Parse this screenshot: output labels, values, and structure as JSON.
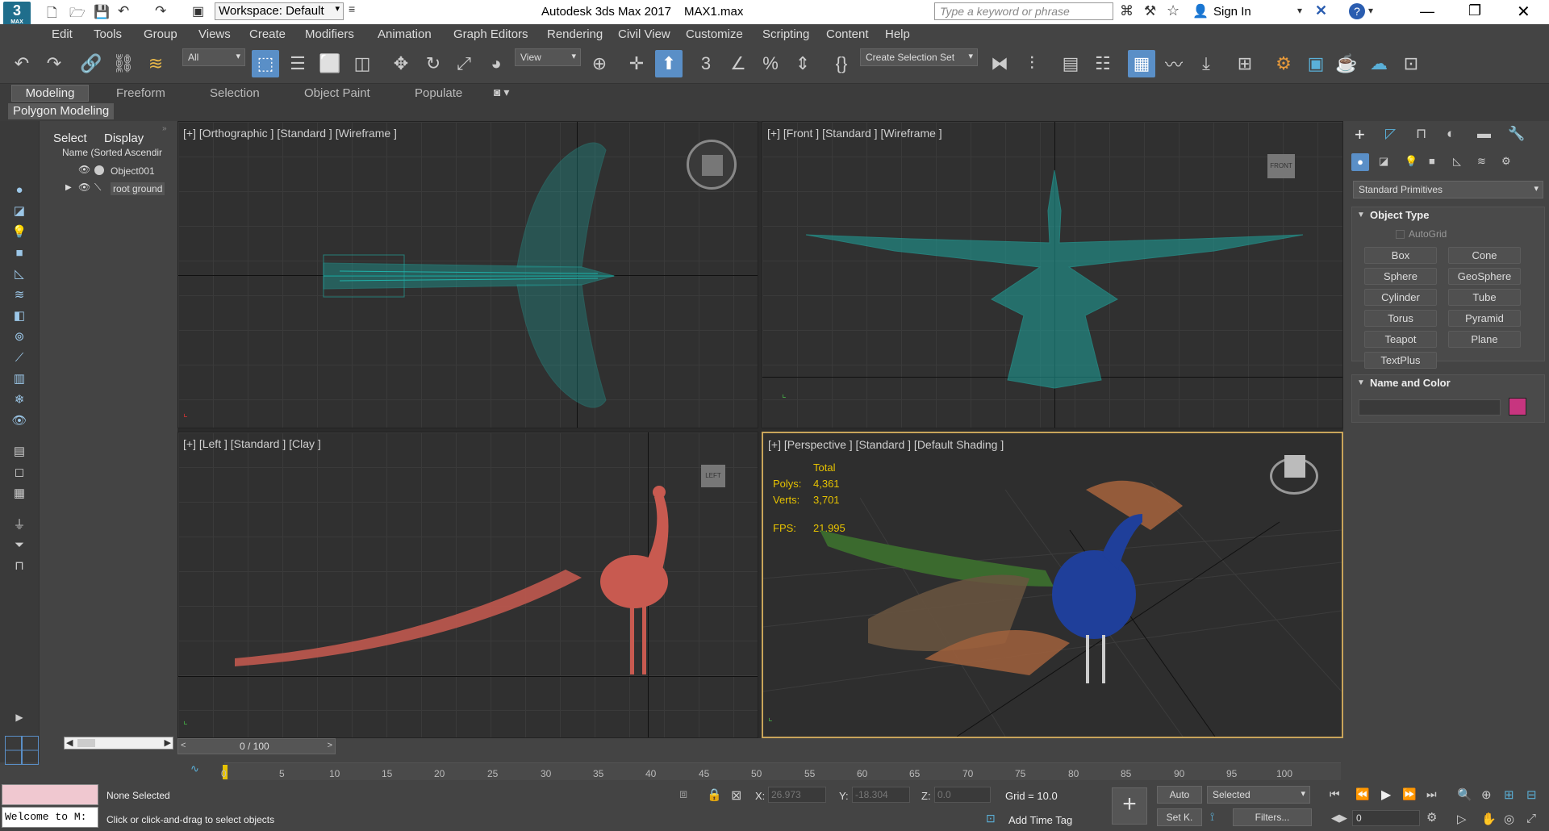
{
  "title": {
    "app_icon": "3",
    "app_icon_sub": "MAX",
    "workspace": "Workspace: Default",
    "app_name": "Autodesk 3ds Max 2017",
    "file_name": "MAX1.max",
    "search_placeholder": "Type a keyword or phrase",
    "sign_in": "Sign In"
  },
  "menu": [
    "Edit",
    "Tools",
    "Group",
    "Views",
    "Create",
    "Modifiers",
    "Animation",
    "Graph Editors",
    "Rendering",
    "Civil View",
    "Customize",
    "Scripting",
    "Content",
    "Help"
  ],
  "toolbar": {
    "filter_value": "All",
    "ref_coord_value": "View",
    "selection_set_value": "Create Selection Set"
  },
  "ribbon": {
    "tabs": [
      "Modeling",
      "Freeform",
      "Selection",
      "Object Paint",
      "Populate"
    ],
    "sub_label": "Polygon Modeling"
  },
  "scene_explorer": {
    "tabs": [
      "Select",
      "Display"
    ],
    "column_header": "Name (Sorted Ascendir",
    "items": [
      "Object001",
      "root ground"
    ]
  },
  "viewports": {
    "top_left": "[+] [Orthographic ] [Standard ] [Wireframe ]",
    "top_right": "[+] [Front ] [Standard ] [Wireframe ]",
    "bottom_left": "[+] [Left ] [Standard ] [Clay ]",
    "bottom_right": "[+] [Perspective ] [Standard ] [Default Shading ]",
    "front_cube": "FRONT",
    "left_cube": "LEFT",
    "stats": {
      "total": "Total",
      "polys_label": "Polys:",
      "polys_value": "4,361",
      "verts_label": "Verts:",
      "verts_value": "3,701",
      "fps_label": "FPS:",
      "fps_value": "21.995"
    }
  },
  "command_panel": {
    "category": "Standard Primitives",
    "object_type_title": "Object Type",
    "autogrid": "AutoGrid",
    "primitives": [
      "Box",
      "Cone",
      "Sphere",
      "GeoSphere",
      "Cylinder",
      "Tube",
      "Torus",
      "Pyramid",
      "Teapot",
      "Plane",
      "TextPlus"
    ],
    "name_color_title": "Name and Color",
    "swatch_color": "#c7357f"
  },
  "timeline": {
    "frame_counter": "0 / 100",
    "ticks": [
      "0",
      "5",
      "10",
      "15",
      "20",
      "25",
      "30",
      "35",
      "40",
      "45",
      "50",
      "55",
      "60",
      "65",
      "70",
      "75",
      "80",
      "85",
      "90",
      "95",
      "100"
    ]
  },
  "status": {
    "maxscript_text": "Welcome to M:",
    "selection_status": "None Selected",
    "prompt": "Click or click-and-drag to select objects",
    "x_label": "X:",
    "x_value": "26.973",
    "y_label": "Y:",
    "y_value": "-18.304",
    "z_label": "Z:",
    "z_value": "0.0",
    "grid": "Grid = 10.0",
    "add_time_tag": "Add Time Tag",
    "auto_key": "Auto",
    "set_key": "Set K.",
    "selected_dropdown": "Selected",
    "filters": "Filters...",
    "frame_value": "0"
  },
  "colors": {
    "accent": "#5a8fc7",
    "wireframe": "#20b2aa",
    "clay": "#c85a50",
    "active_border": "#c8a45a"
  }
}
